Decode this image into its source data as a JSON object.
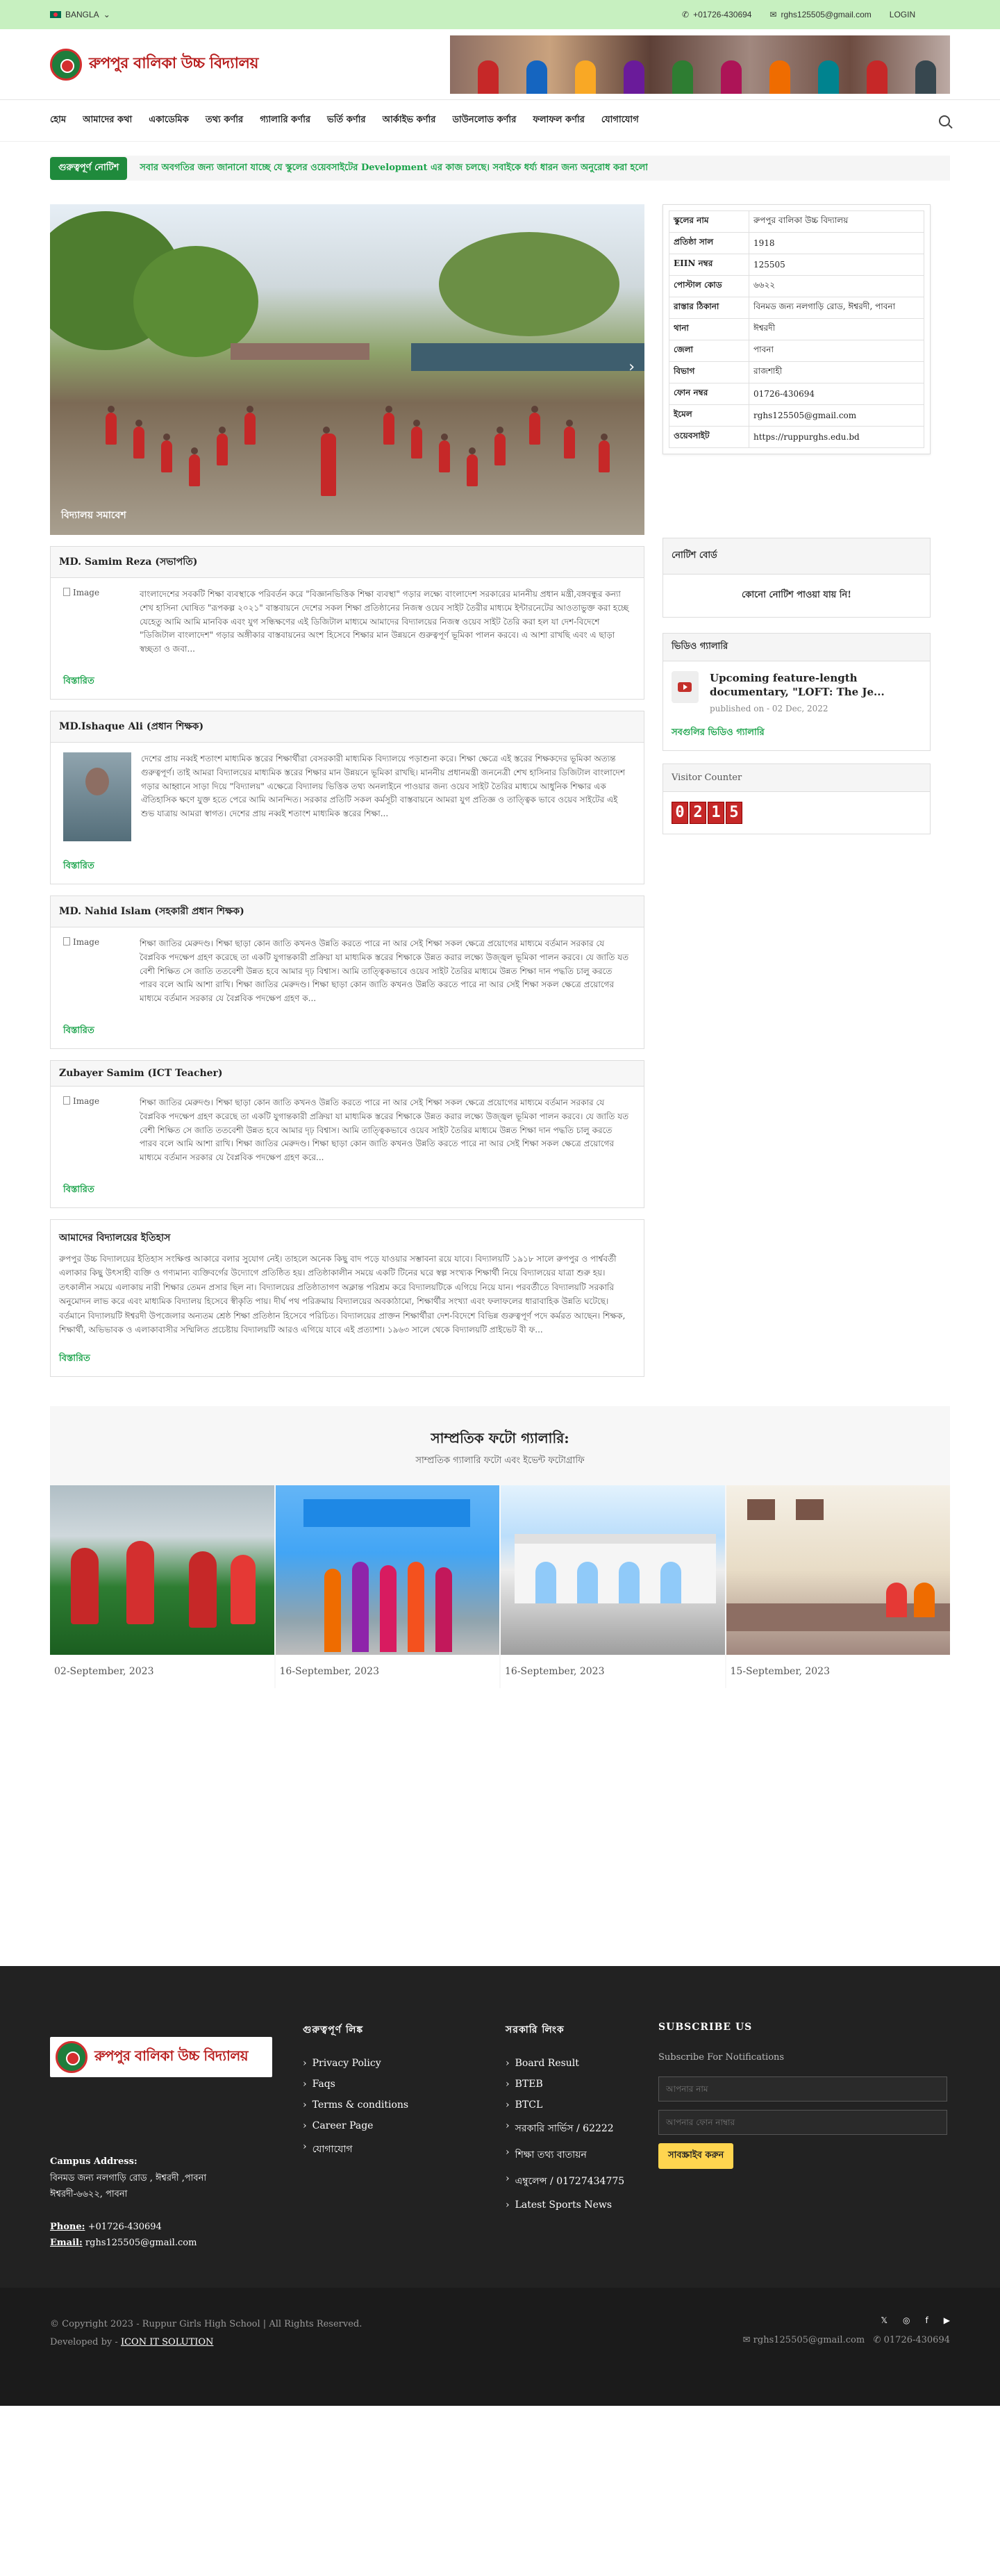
{
  "topbar": {
    "language": "BANGLA",
    "phone": "+01726-430694",
    "email": "rghs125505@gmail.com",
    "login": "LOGIN"
  },
  "header": {
    "school_name": "রুপপুর বালিকা উচ্চ বিদ্যালয়"
  },
  "nav": {
    "items": [
      "হোম",
      "আমাদের কথা",
      "একাডেমিক",
      "তথ্য কর্ণার",
      "গ্যালারি কর্ণার",
      "ভর্তি কর্ণার",
      "আর্কাইভ কর্ণার",
      "ডাউনলোড কর্ণার",
      "ফলাফল কর্ণার",
      "যোগাযোগ"
    ]
  },
  "notice": {
    "badge": "গুরুত্বপূর্ণ নোটিশ",
    "text": "সবার অবগতির জন্য জানানো যাচ্ছে যে স্কুলের ওয়েবসাইটের Development এর কাজ চলছে। সবাইকে ধর্য্য ধারন জন্য অনুরোধ করা হলো"
  },
  "slider": {
    "caption": "বিদ্যালয় সমাবেশ"
  },
  "people": [
    {
      "title": "MD. Samim Reza (সভাপতি)",
      "image": "broken",
      "image_alt": "Image",
      "text": "বাংলাদেশের সবকটি শিক্ষা ব্যবস্থাকে পরিবর্তন করে \"বিজ্ঞানভিত্তিক শিক্ষা ব্যবস্থা\" গড়ার লক্ষ্যে বাংলাদেশ সরকারের মাননীয় প্রধান মন্ত্রী,বঙ্গবন্ধুর কন্যা শেখ হাসিনা ঘোষিত \"রূপকল্প ২০২১\" বাস্তবায়নে দেশের সকল শিক্ষা প্রতিষ্ঠানের নিজস্ব ওয়েব সাইট তৈরীর মাধ্যমে ইন্টারনেটের আওতাভুক্ত করা হচ্ছে যেহেতু আমি আমি মানবিক এবং যুগ সন্ধিক্ষণের এই ডিজিটাল মাধ্যমে আমাদের বিদ্যালয়ের নিজস্ব ওয়েব সাইট তৈরি করা হল যা দেশ-বিদেশে \"ডিজিটাল বাংলাদেশ\" গড়ার অঙ্গীকার বাস্তবায়নের অংশ হিসেবে শিক্ষার মান উন্নয়নে গুরুত্বপূর্ণ ভূমিকা পালন করবে। এ আশা রাখছি এবং এ ছাড়া স্বচ্ছতা ও জবা...",
      "more": "বিস্তারিত"
    },
    {
      "title": "MD.Ishaque Ali (প্রধান শিক্ষক)",
      "image": "photo",
      "image_alt": "",
      "text": "দেশের প্রায় নব্বই শতাংশ মাধ্যমিক স্তরের শিক্ষার্থীরা বেসরকারী মাধ্যমিক বিদ্যালয়ে পড়াশুনা করে। শিক্ষা ক্ষেত্রে এই স্তরের শিক্ষকদের ভূমিকা অত্যন্ত গুরুত্বপূর্ণ। তাই আমরা বিদ্যালয়ের মাধ্যমিক স্তরের শিক্ষার মান উন্নয়নে ভূমিকা রাখছি। মাননীয় প্রধানমন্ত্রী জননেত্রী শেখ হাসিনার ডিজিটাল বাংলাদেশ গড়ার আহ্বানে সাড়া দিয়ে \"বিদ্যালয়\" এক্ষেত্রে বিদ্যালয় ভিত্তিক তথ্য অনলাইনে পাওয়ার জন্য ওয়েব সাইট তৈরির মাধ্যমে আধুনিক শিক্ষার এক ঐতিহাসিক ক্ষণে যুক্ত হতে পেরে আমি আনন্দিত। সরকার প্রতিটি সকল কর্মসূচী বাস্তবায়নে আমরা যুগ প্রতিজ্ঞ ও তাত্ত্বিক ভাবে ওয়েব সাইটের এই শুভ যাত্রায় আমরা স্বাগত। দেশের প্রায় নব্বই শতাংশ মাধ্যমিক স্তরের শিক্ষা...",
      "more": "বিস্তারিত"
    },
    {
      "title": "MD. Nahid Islam (সহকারী প্রধান শিক্ষক)",
      "image": "broken",
      "image_alt": "Image",
      "text": "শিক্ষা জাতির মেরুদণ্ড। শিক্ষা ছাড়া কোন জাতি কখনও উন্নতি করতে পারে না আর সেই শিক্ষা সকল ক্ষেত্রে প্রয়োগের মাধ্যমে বর্তমান সরকার যে বৈপ্লবিক পদক্ষেপ গ্রহণ করেছে তা একটি যুগান্তকারী প্রক্রিয়া যা মাধ্যমিক স্তরের শিক্ষাকে উন্নত করার লক্ষ্যে উজ্জ্বল ভূমিকা পালন করবে। যে জাতি যত বেশী শিক্ষিত সে জাতি ততবেশী উন্নত হবে আমার দৃঢ় বিশ্বাস। আমি তাত্ত্বিকভাবে ওয়েব সাইট তৈরির মাধ্যমে উন্নত শিক্ষা দান পদ্ধতি চালু করতে পারব বলে আমি আশা রাখি। শিক্ষা জাতির মেরুদণ্ড। শিক্ষা ছাড়া কোন জাতি কখনও উন্নতি করতে পারে না আর সেই শিক্ষা সকল ক্ষেত্রে প্রয়োগের মাধ্যমে বর্তমান সরকার যে বৈপ্লবিক পদক্ষেপ গ্রহণ ক...",
      "more": "বিস্তারিত"
    },
    {
      "title": "Zubayer Samim (ICT Teacher)",
      "image": "broken",
      "image_alt": "Image",
      "text": "শিক্ষা জাতির মেরুদণ্ড। শিক্ষা ছাড়া কোন জাতি কখনও উন্নতি করতে পারে না আর সেই শিক্ষা সকল ক্ষেত্রে প্রয়োগের মাধ্যমে বর্তমান সরকার যে বৈপ্লবিক পদক্ষেপ গ্রহণ করেছে তা একটি যুগান্তকারী প্রক্রিয়া যা মাধ্যমিক স্তরের শিক্ষাকে উন্নত করার লক্ষ্যে উজ্জ্বল ভূমিকা পালন করবে। যে জাতি যত বেশী শিক্ষিত সে জাতি ততবেশী উন্নত হবে আমার দৃঢ় বিশ্বাস। আমি তাত্ত্বিকভাবে ওয়েব সাইট তৈরির মাধ্যমে উন্নত শিক্ষা দান পদ্ধতি চালু করতে পারব বলে আমি আশা রাখি। শিক্ষা জাতির মেরুদণ্ড। শিক্ষা ছাড়া কোন জাতি কখনও উন্নতি করতে পারে না আর সেই শিক্ষা সকল ক্ষেত্রে প্রয়োগের মাধ্যমে বর্তমান সরকার যে বৈপ্লবিক পদক্ষেপ গ্রহণ করে...",
      "more": "বিস্তারিত"
    }
  ],
  "history": {
    "title": "আমাদের বিদ্যালয়ের ইতিহাস",
    "text": "রুপপুর উচ্চ বিদ্যালয়ের ইতিহাস সংক্ষিপ্ত আকারে বলার সুযোগ নেই। তাহলে অনেক কিছু বাদ পড়ে যাওয়ার সম্ভাবনা রয়ে যাবে। বিদ্যালয়টি ১৯১৮ সালে রুপপুর ও পার্শ্ববর্তী এলাকার কিছু উৎসাহী ব্যক্তি ও গণ্যমান্য ব্যক্তিবর্গের উদ্যোগে প্রতিষ্ঠিত হয়। প্রতিষ্ঠাকালীন সময়ে একটি টিনের ঘরে স্বল্প সংখ্যক শিক্ষার্থী নিয়ে বিদ্যালয়ের যাত্রা শুরু হয়। তৎকালীন সময়ে এলাকায় নারী শিক্ষার তেমন প্রসার ছিল না। বিদ্যালয়ের প্রতিষ্ঠাতাগণ অক্লান্ত পরিশ্রম করে বিদ্যালয়টিকে এগিয়ে নিয়ে যান। পরবর্তীতে বিদ্যালয়টি সরকারি অনুমোদন লাভ করে এবং মাধ্যমিক বিদ্যালয় হিসেবে স্বীকৃতি পায়। দীর্ঘ পথ পরিক্রমায় বিদ্যালয়ের অবকাঠামো, শিক্ষার্থীর সংখ্যা এবং ফলাফলের ধারাবাহিক উন্নতি ঘটেছে। বর্তমানে বিদ্যালয়টি ঈশ্বরদী উপজেলার অন্যতম শ্রেষ্ঠ শিক্ষা প্রতিষ্ঠান হিসেবে পরিচিত। বিদ্যালয়ের প্রাক্তন শিক্ষার্থীরা দেশ-বিদেশে বিভিন্ন গুরুত্বপূর্ণ পদে কর্মরত আছেন। শিক্ষক, শিক্ষার্থী, অভিভাবক ও এলাকাবাসীর সম্মিলিত প্রচেষ্টায় বিদ্যালয়টি আরও এগিয়ে যাবে এই প্রত্যাশা। ১৯৬৩ সালে থেকে বিদ্যালয়টি প্রাইভেট বী ফ...",
    "more": "বিস্তারিত"
  },
  "school_info": {
    "rows": [
      {
        "label": "স্কুলের নাম",
        "value": "রুপপুর বালিকা উচ্চ বিদ্যালয়"
      },
      {
        "label": "প্রতিষ্ঠা সাল",
        "value": "1918"
      },
      {
        "label": "EIIN নম্বর",
        "value": "125505"
      },
      {
        "label": "পোস্টাল কোড",
        "value": "৬৬২২"
      },
      {
        "label": "রাস্তার ঠিকানা",
        "value": "বিনমড জন্য নলগাড়ি রোড, ঈশ্বরদী, পাবনা"
      },
      {
        "label": "থানা",
        "value": "ঈশ্বরদী"
      },
      {
        "label": "জেলা",
        "value": "পাবনা"
      },
      {
        "label": "বিভাগ",
        "value": "রাজশাহী"
      },
      {
        "label": "ফোন নম্বর",
        "value": "01726-430694"
      },
      {
        "label": "ইমেল",
        "value": "rghs125505@gmail.com"
      },
      {
        "label": "ওয়েবসাইট",
        "value": "https://ruppurghs.edu.bd"
      }
    ]
  },
  "notice_board": {
    "title": "নোটিশ বোর্ড",
    "empty": "কোনো নোটিশ পাওয়া যায় নি!"
  },
  "video_gallery": {
    "title": "ভিডিও গ্যালারি",
    "video_title": "Upcoming feature-length documentary, \"LOFT: The Je...",
    "video_date": "published on - 02 Dec, 2022",
    "more": "সবগুলির ভিডিও গ্যালারি"
  },
  "visitor": {
    "title": "Visitor Counter",
    "digits": [
      "0",
      "2",
      "1",
      "5"
    ]
  },
  "gallery": {
    "title": "সাম্প্রতিক ফটো গ্যালারি:",
    "subtitle": "সাম্প্রতিক গ্যালারি ফটো এবং ইভেন্ট ফটোগ্রাফি",
    "items": [
      {
        "date": "02-September, 2023",
        "scene": "dance"
      },
      {
        "date": "16-September, 2023",
        "scene": "group"
      },
      {
        "date": "16-September, 2023",
        "scene": "building"
      },
      {
        "date": "15-September, 2023",
        "scene": "office"
      }
    ]
  },
  "footer": {
    "school_name": "রুপপুর বালিকা উচ্চ বিদ্যালয়",
    "address_label": "Campus Address:",
    "address": "বিনমড জন্য নলগাড়ি রোড , ঈশ্বরদী ,পাবনা",
    "address2": "ঈশ্বরদী-৬৬২২, পাবনা",
    "phone_label": "Phone:",
    "phone": "+01726-430694",
    "email_label": "Email:",
    "email": "rghs125505@gmail.com",
    "col2_title": "গুরুত্বপূর্ণ লিঙ্ক",
    "col2_links": [
      "Privacy Policy",
      "Faqs",
      "Terms & conditions",
      "Career Page",
      "যোগাযোগ"
    ],
    "col3_title": "সরকারি লিংক",
    "col3_links": [
      "Board Result",
      "BTEB",
      "BTCL",
      "সরকারি সার্ভিস / 62222",
      "শিক্ষা তথ্য বাতায়ন",
      "এম্বুলেন্স / 01727434775",
      "Latest Sports News"
    ],
    "subscribe_title": "SUBSCRIBE US",
    "subscribe_label": "Subscribe For Notifications",
    "name_placeholder": "আপনার নাম",
    "phone_placeholder": "আপনার ফোন নাম্বার",
    "subscribe_button": "সাবস্ক্রাইব করুন",
    "copyright": "© Copyright 2023 - Ruppur Girls High School | All Rights Reserved.",
    "developed_by": "Developed by -",
    "developer": "ICON IT SOLUTION",
    "social": [
      "twitter-icon",
      "instagram-icon",
      "facebook-icon",
      "youtube-icon"
    ],
    "bottom_email": "rghs125505@gmail.com",
    "bottom_phone": "01726-430694"
  },
  "colors": {
    "accent": "#1aa34a",
    "topbar": "#c7f0c0",
    "footer": "#222222"
  }
}
